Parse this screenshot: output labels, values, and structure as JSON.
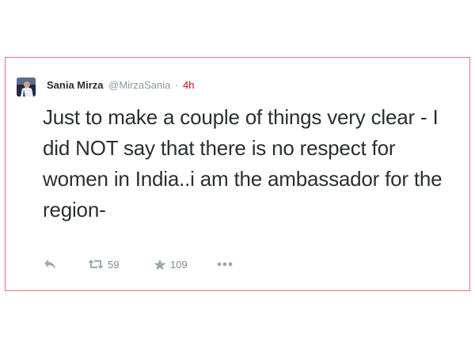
{
  "tweet": {
    "author_name": "Sania Mirza",
    "handle": "@MirzaSania",
    "separator": "·",
    "time": "4h",
    "text": "Just to make a couple of things very clear - I did NOT say that there is no respect for women in India..i am the ambassador for the region-",
    "retweets": "59",
    "favorites": "109"
  },
  "icons": {
    "reply": "reply-icon",
    "retweet": "retweet-icon",
    "favorite": "star-icon",
    "more": "more-options-icon"
  },
  "colors": {
    "card_border": "#e8737a",
    "time": "#d0021b",
    "icon": "#99aab5"
  }
}
